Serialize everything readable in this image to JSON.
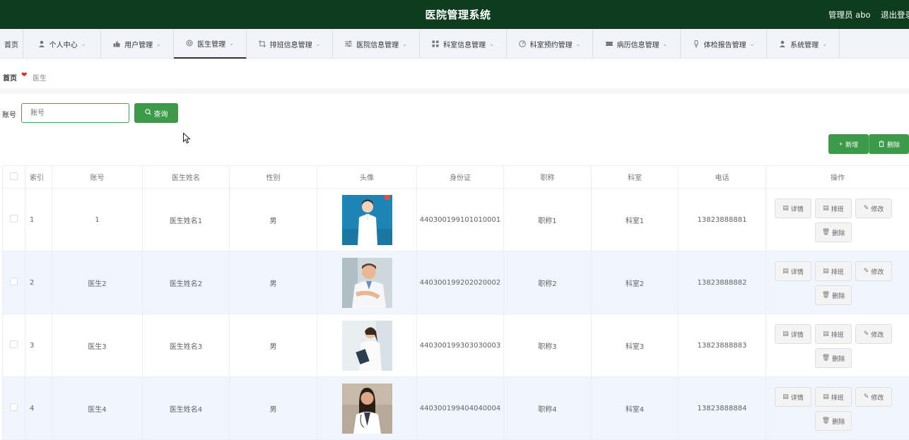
{
  "header": {
    "title": "医院管理系统",
    "admin_label": "管理员 abo",
    "logout_label": "退出登录"
  },
  "nav": {
    "items": [
      {
        "label": "首页",
        "icon": "",
        "chevron": ""
      },
      {
        "label": "个人中心",
        "icon": "person-icon",
        "chevron": "⌄"
      },
      {
        "label": "用户管理",
        "icon": "thumb-icon",
        "chevron": "⌄"
      },
      {
        "label": "医生管理",
        "icon": "circle-icon",
        "chevron": "⌄"
      },
      {
        "label": "排班信息管理",
        "icon": "crop-icon",
        "chevron": "⌄"
      },
      {
        "label": "医院信息管理",
        "icon": "sliders-icon",
        "chevron": "⌄"
      },
      {
        "label": "科室信息管理",
        "icon": "grid-icon",
        "chevron": "⌄"
      },
      {
        "label": "科室预约管理",
        "icon": "gauge-icon",
        "chevron": "⌄"
      },
      {
        "label": "病历信息管理",
        "icon": "ticket-icon",
        "chevron": "⌄"
      },
      {
        "label": "体检报告管理",
        "icon": "bulb-icon",
        "chevron": "⌄"
      },
      {
        "label": "系统管理",
        "icon": "person-icon",
        "chevron": "⌄"
      }
    ]
  },
  "breadcrumb": {
    "home": "首页",
    "current": "医生"
  },
  "search": {
    "label": "账号",
    "placeholder": "账号",
    "value": "",
    "button": "查询"
  },
  "toolbar": {
    "add_label": "新增",
    "delete_label": "删除"
  },
  "table": {
    "headers": [
      "索引",
      "账号",
      "医生姓名",
      "性别",
      "头像",
      "身份证",
      "职称",
      "科室",
      "电话",
      "操作"
    ],
    "rows": [
      {
        "index": "1",
        "account": "1",
        "name": "医生姓名1",
        "gender": "男",
        "id_card": "440300199101010001",
        "title": "职称1",
        "dept": "科室1",
        "phone": "13823888881"
      },
      {
        "index": "2",
        "account": "医生2",
        "name": "医生姓名2",
        "gender": "男",
        "id_card": "440300199202020002",
        "title": "职称2",
        "dept": "科室2",
        "phone": "13823888882"
      },
      {
        "index": "3",
        "account": "医生3",
        "name": "医生姓名3",
        "gender": "男",
        "id_card": "440300199303030003",
        "title": "职称3",
        "dept": "科室3",
        "phone": "13823888883"
      },
      {
        "index": "4",
        "account": "医生4",
        "name": "医生姓名4",
        "gender": "男",
        "id_card": "440300199404040004",
        "title": "职称4",
        "dept": "科室4",
        "phone": "13823888884"
      }
    ],
    "ops": {
      "detail": "详情",
      "schedule": "排班",
      "edit": "修改",
      "delete": "删除"
    }
  },
  "colors": {
    "topbar": "#0d3d1c",
    "primary_button": "#3d9a4a",
    "heart": "#e02424",
    "alt_row": "#f1f6fd"
  }
}
